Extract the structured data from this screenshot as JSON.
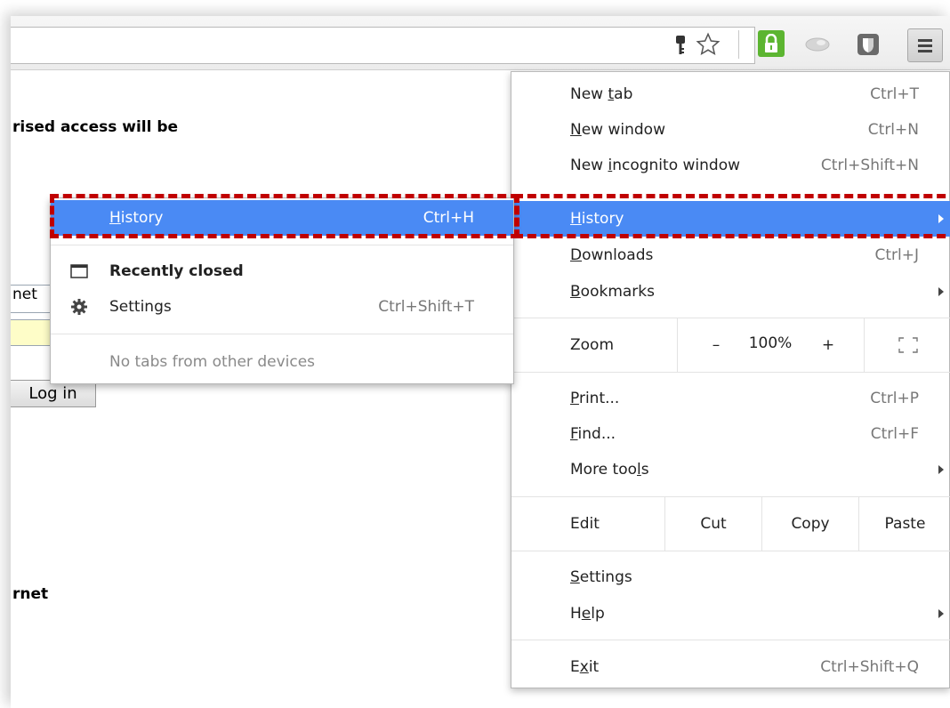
{
  "page": {
    "line1": "rised access will be",
    "input_value": "net",
    "login_label": "Log in",
    "line2": "rnet"
  },
  "toolbar": {
    "icons": [
      "key-icon",
      "star-icon",
      "lock-extension-icon",
      "extension-icon",
      "shield-extension-icon",
      "menu-icon"
    ]
  },
  "menu": {
    "new_tab": {
      "pre": "New ",
      "ul": "t",
      "post": "ab",
      "shortcut": "Ctrl+T"
    },
    "new_window": {
      "pre": "",
      "ul": "N",
      "post": "ew window",
      "shortcut": "Ctrl+N"
    },
    "new_incognito": {
      "pre": "New ",
      "ul": "i",
      "post": "ncognito window",
      "shortcut": "Ctrl+Shift+N"
    },
    "history": {
      "pre": "",
      "ul": "H",
      "post": "istory"
    },
    "downloads": {
      "pre": "",
      "ul": "D",
      "post": "ownloads",
      "shortcut": "Ctrl+J"
    },
    "bookmarks": {
      "pre": "",
      "ul": "B",
      "post": "ookmarks"
    },
    "zoom": {
      "label": "Zoom",
      "minus": "–",
      "level": "100%",
      "plus": "+"
    },
    "print": {
      "pre": "",
      "ul": "P",
      "post": "rint...",
      "shortcut": "Ctrl+P"
    },
    "find": {
      "pre": "",
      "ul": "F",
      "post": "ind...",
      "shortcut": "Ctrl+F"
    },
    "more_tools": {
      "pre": "More too",
      "ul": "l",
      "post": "s"
    },
    "edit": {
      "label": "Edit",
      "cut": "Cut",
      "copy": "Copy",
      "paste": "Paste"
    },
    "settings": {
      "pre": "",
      "ul": "S",
      "post": "ettings"
    },
    "help": {
      "pre": "H",
      "ul": "e",
      "post": "lp"
    },
    "exit": {
      "pre": "E",
      "ul": "x",
      "post": "it",
      "shortcut": "Ctrl+Shift+Q"
    }
  },
  "submenu": {
    "history": {
      "pre": "",
      "ul": "H",
      "post": "istory",
      "shortcut": "Ctrl+H"
    },
    "recently_closed": "Recently closed",
    "settings": {
      "label": "Settings",
      "shortcut": "Ctrl+Shift+T"
    },
    "no_tabs": "No tabs from other devices"
  },
  "colors": {
    "highlight": "#4a8af4",
    "annotation": "#c00000"
  }
}
